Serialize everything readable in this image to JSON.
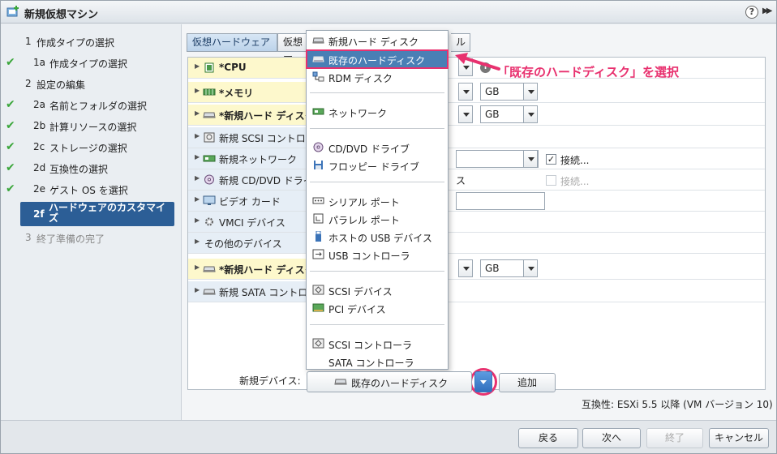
{
  "window": {
    "title": "新規仮想マシン",
    "help_label": "?",
    "expand_label": "▶▶"
  },
  "sidebar": {
    "steps": [
      {
        "num": "1",
        "label": "作成タイプの選択"
      },
      {
        "num": "1a",
        "label": "作成タイプの選択"
      },
      {
        "num": "2",
        "label": "設定の編集"
      },
      {
        "num": "2a",
        "label": "名前とフォルダの選択"
      },
      {
        "num": "2b",
        "label": "計算リソースの選択"
      },
      {
        "num": "2c",
        "label": "ストレージの選択"
      },
      {
        "num": "2d",
        "label": "互換性の選択"
      },
      {
        "num": "2e",
        "label": "ゲスト OS を選択"
      },
      {
        "num": "2f",
        "label": "ハードウェアのカスタマイズ"
      },
      {
        "num": "3",
        "label": "終了準備の完了"
      }
    ],
    "check_glyph": "✔"
  },
  "tabs": {
    "virtual_hardware": "仮想ハードウェア",
    "vm_options": "仮想マ",
    "sdrs_tail": "ル"
  },
  "hardware": {
    "rows": [
      {
        "label": "*CPU"
      },
      {
        "label": "*メモリ"
      },
      {
        "label": "*新規ハード ディスク"
      },
      {
        "label": "新規 SCSI コントロー"
      },
      {
        "label": "新規ネットワーク"
      },
      {
        "label": "新規 CD/DVD ドライ"
      },
      {
        "label": "ビデオ カード"
      },
      {
        "label": "VMCI デバイス"
      },
      {
        "label": "その他のデバイス"
      },
      {
        "label": "*新規ハード ディスク"
      },
      {
        "label": "新規 SATA コントロー"
      }
    ],
    "memory_unit": "GB",
    "disk_unit": "GB",
    "disk2_unit": "GB",
    "connect_label": "接続...",
    "connect_label_cd": "接続...",
    "cd_tail": "ス",
    "check_glyph": "✓",
    "info_glyph": "i"
  },
  "menu": {
    "items": [
      {
        "label": "新規ハード ディスク",
        "icon": "hard-disk-icon"
      },
      {
        "label": "既存のハードディスク",
        "icon": "existing-disk-icon"
      },
      {
        "label": "RDM ディスク",
        "icon": "rdm-disk-icon"
      },
      {
        "label": "ネットワーク",
        "icon": "network-icon"
      },
      {
        "label": "CD/DVD ドライブ",
        "icon": "cd-dvd-icon"
      },
      {
        "label": "フロッピー ドライブ",
        "icon": "floppy-icon"
      },
      {
        "label": "シリアル ポート",
        "icon": "serial-port-icon"
      },
      {
        "label": "パラレル ポート",
        "icon": "parallel-port-icon"
      },
      {
        "label": "ホストの USB デバイス",
        "icon": "usb-device-icon"
      },
      {
        "label": "USB コントローラ",
        "icon": "usb-controller-icon"
      },
      {
        "label": "SCSI デバイス",
        "icon": "scsi-device-icon"
      },
      {
        "label": "PCI デバイス",
        "icon": "pci-device-icon"
      },
      {
        "label": "SCSI コントローラ",
        "icon": "scsi-controller-icon"
      },
      {
        "label": "SATA コントローラ",
        "icon": ""
      }
    ]
  },
  "annotation": {
    "text": "「既存のハードディスク」を選択",
    "color": "#e8316f"
  },
  "new_device": {
    "label": "新規デバイス:",
    "selected": "既存のハードディスク",
    "add_label": "追加"
  },
  "compatibility": "互換性: ESXi 5.5 以降 (VM バージョン 10)",
  "footer": {
    "back": "戻る",
    "next": "次へ",
    "finish": "終了",
    "cancel": "キャンセル"
  },
  "colors": {
    "accent": "#2c5e96",
    "highlight": "#4a7fb5",
    "check": "#3aa63a",
    "changed_row": "#fdf8cc"
  }
}
